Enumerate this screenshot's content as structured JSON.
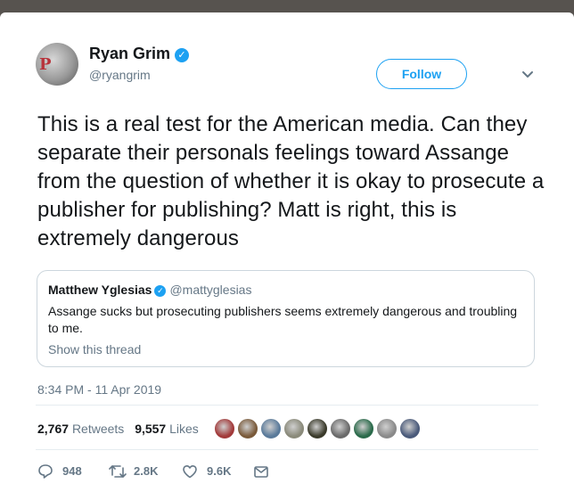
{
  "author": {
    "name": "Ryan Grim",
    "handle": "@ryangrim",
    "verified": true,
    "avatar_letter": "P"
  },
  "follow_label": "Follow",
  "tweet_text": "This is a real test for the American media. Can they separate their personals feelings toward Assange from the question of whether it is okay to prosecute a publisher for publishing? Matt is right, this is extremely dangerous",
  "quote": {
    "name": "Matthew Yglesias",
    "handle": "@mattyglesias",
    "text": "Assange sucks but prosecuting publishers seems extremely dangerous and troubling to me.",
    "show_thread": "Show this thread"
  },
  "timestamp": "8:34 PM - 11 Apr 2019",
  "stats": {
    "retweets_count": "2,767",
    "retweets_label": "Retweets",
    "likes_count": "9,557",
    "likes_label": "Likes"
  },
  "likers": [
    {
      "color": "#a23a3a"
    },
    {
      "color": "#7a5a3a"
    },
    {
      "color": "#5a7a9a"
    },
    {
      "color": "#8a8a7a"
    },
    {
      "color": "#3a3a2a"
    },
    {
      "color": "#6a6a6a"
    },
    {
      "color": "#2a6a4a"
    },
    {
      "color": "#8a8a8a"
    },
    {
      "color": "#4a5a7a"
    }
  ],
  "actions": {
    "replies": "948",
    "retweets": "2.8K",
    "likes": "9.6K"
  },
  "colors": {
    "accent": "#1da1f2",
    "text": "#14171a",
    "muted": "#657786",
    "border": "#ccd6dd"
  }
}
